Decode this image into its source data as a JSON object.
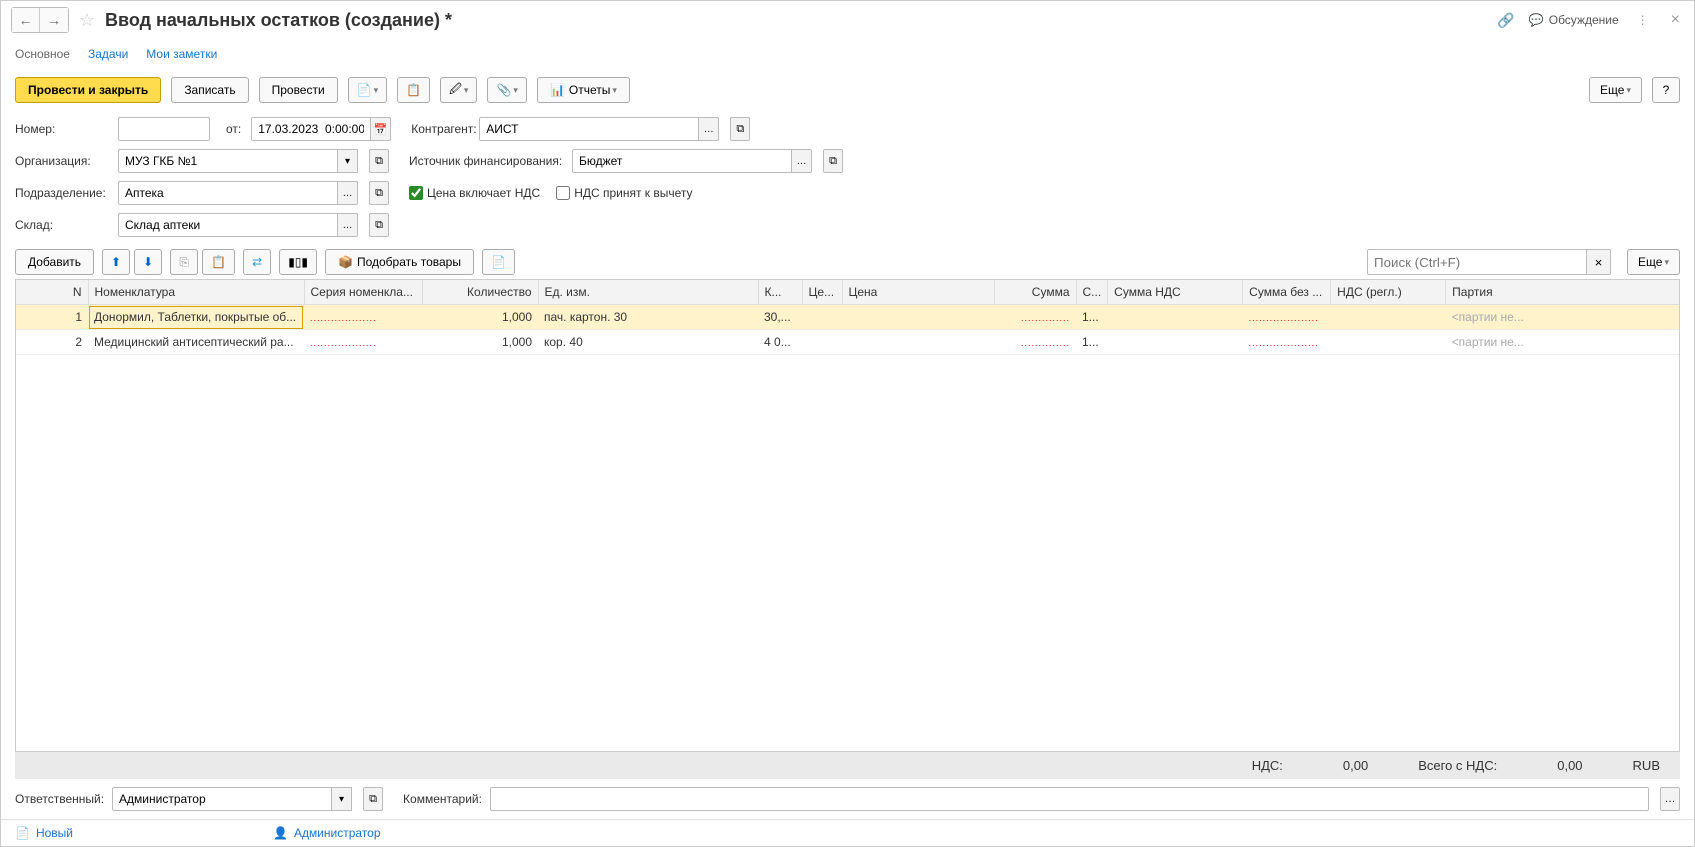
{
  "header": {
    "title": "Ввод начальных остатков (создание) *",
    "discuss": "Обсуждение"
  },
  "tabs": {
    "main": "Основное",
    "tasks": "Задачи",
    "notes": "Мои заметки"
  },
  "toolbar": {
    "post_close": "Провести и закрыть",
    "save": "Записать",
    "post": "Провести",
    "reports": "Отчеты",
    "more": "Еще",
    "help": "?"
  },
  "form": {
    "number_label": "Номер:",
    "number_value": "",
    "from_label": "от:",
    "date_value": "17.03.2023  0:00:00",
    "contractor_label": "Контрагент:",
    "contractor_value": "АИСТ",
    "org_label": "Организация:",
    "org_value": "МУЗ ГКБ №1",
    "fin_label": "Источник финансирования:",
    "fin_value": "Бюджет",
    "dept_label": "Подразделение:",
    "dept_value": "Аптека",
    "price_incl_vat": "Цена включает НДС",
    "vat_deducted": "НДС принят к вычету",
    "warehouse_label": "Склад:",
    "warehouse_value": "Склад аптеки"
  },
  "tbl_toolbar": {
    "add": "Добавить",
    "pick": "Подобрать товары",
    "search_placeholder": "Поиск (Ctrl+F)",
    "more": "Еще"
  },
  "table": {
    "headers": {
      "n": "N",
      "nom": "Номенклатура",
      "ser": "Серия номенкла...",
      "qty": "Количество",
      "unit": "Ед. изм.",
      "k": "К...",
      "cen": "Це...",
      "cena": "Цена",
      "sum": "Сумма",
      "s": "С...",
      "sumnds": "Сумма НДС",
      "sumbez": "Сумма без ...",
      "ndsr": "НДС (регл.)",
      "part": "Партия"
    },
    "rows": [
      {
        "n": "1",
        "nom": "Донормил, Таблетки, покрытые об...",
        "qty": "1,000",
        "unit": "пач. картон. 30",
        "k": "30,...",
        "s": "1...",
        "part": "<партии не..."
      },
      {
        "n": "2",
        "nom": "Медицинский антисептический ра...",
        "qty": "1,000",
        "unit": "кор. 40",
        "k": "4 0...",
        "s": "1...",
        "part": "<партии не..."
      }
    ]
  },
  "totals": {
    "nds_label": "НДС:",
    "nds_value": "0,00",
    "total_label": "Всего с НДС:",
    "total_value": "0,00",
    "currency": "RUB"
  },
  "footer": {
    "resp_label": "Ответственный:",
    "resp_value": "Администратор",
    "comment_label": "Комментарий:",
    "comment_value": ""
  },
  "status": {
    "new": "Новый",
    "user": "Администратор"
  }
}
